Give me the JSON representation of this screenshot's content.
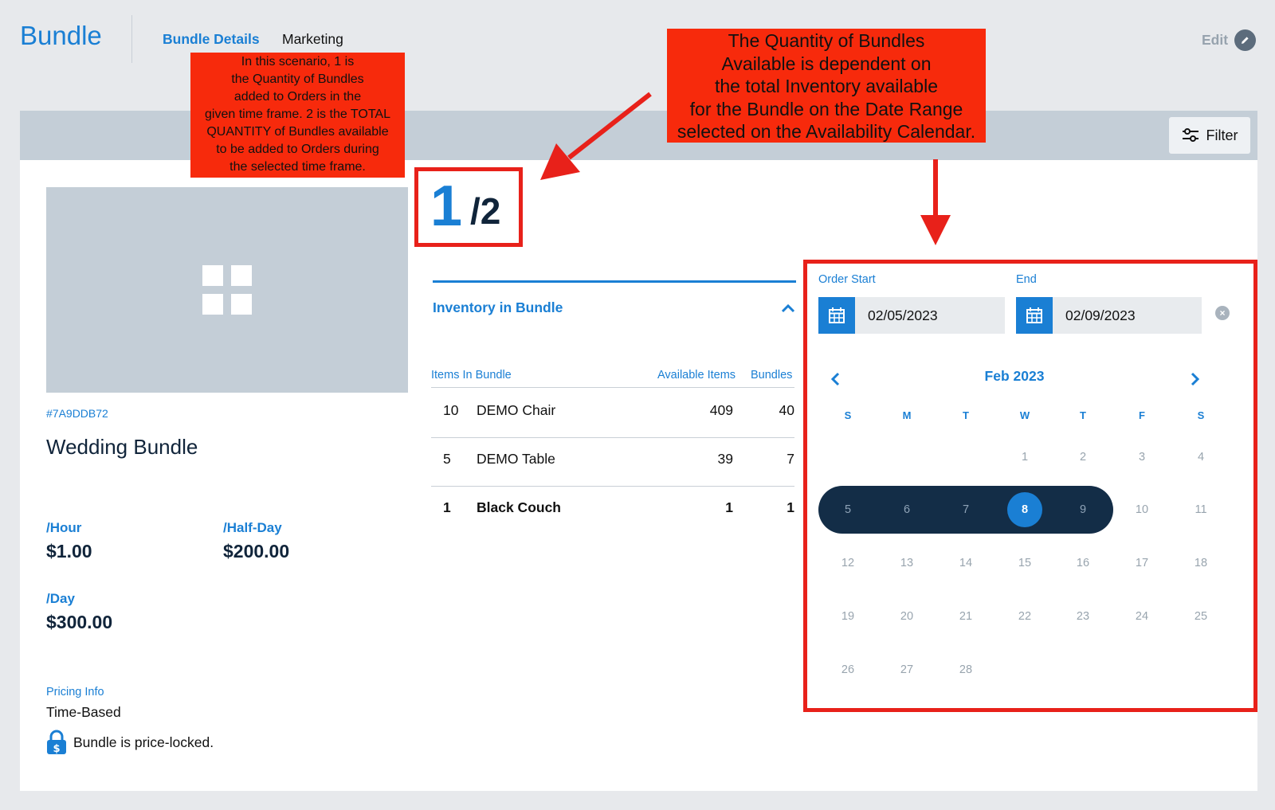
{
  "header": {
    "app_title": "Bundle",
    "tabs": [
      {
        "label": "Bundle Details",
        "active": true
      },
      {
        "label": "Marketing",
        "active": false
      }
    ],
    "edit_label": "Edit"
  },
  "toolbar": {
    "filter_label": "Filter"
  },
  "bundle": {
    "code": "#7A9DDB72",
    "name": "Wedding Bundle",
    "prices": [
      {
        "label": "/Hour",
        "value": "$1.00"
      },
      {
        "label": "/Half-Day",
        "value": "$200.00"
      },
      {
        "label": "/Day",
        "value": "$300.00"
      }
    ],
    "pricing_info_label": "Pricing Info",
    "pricing_info_value": "Time-Based",
    "price_locked_text": "Bundle is price-locked."
  },
  "availability": {
    "used": "1",
    "total": "/2"
  },
  "inventory": {
    "title": "Inventory in Bundle",
    "headers": [
      "Items In Bundle",
      "Available Items",
      "Bundles"
    ],
    "rows": [
      {
        "qty": "10",
        "item": "DEMO Chair",
        "available": "409",
        "bundles": "40",
        "bold": false
      },
      {
        "qty": "5",
        "item": "DEMO Table",
        "available": "39",
        "bundles": "7",
        "bold": false
      },
      {
        "qty": "1",
        "item": "Black Couch",
        "available": "1",
        "bundles": "1",
        "bold": true
      }
    ]
  },
  "calendar": {
    "start_label": "Order Start",
    "start_value": "02/05/2023",
    "end_label": "End",
    "end_value": "02/09/2023",
    "month_label": "Feb 2023",
    "weekdays": [
      "S",
      "M",
      "T",
      "W",
      "T",
      "F",
      "S"
    ],
    "weeks": [
      [
        "",
        "",
        "",
        "1",
        "2",
        "3",
        "4"
      ],
      [
        "5",
        "6",
        "7",
        "8",
        "9",
        "10",
        "11"
      ],
      [
        "12",
        "13",
        "14",
        "15",
        "16",
        "17",
        "18"
      ],
      [
        "19",
        "20",
        "21",
        "22",
        "23",
        "24",
        "25"
      ],
      [
        "26",
        "27",
        "28",
        "",
        "",
        "",
        ""
      ]
    ],
    "selected_day": "8",
    "range_days": [
      "5",
      "6",
      "7",
      "8",
      "9"
    ]
  },
  "annotations": {
    "left_note": [
      "In this scenario, 1 is",
      "the Quantity of Bundles",
      "added to Orders in the",
      "given time frame. 2 is the TOTAL",
      "QUANTITY of Bundles available",
      "to be added to Orders during",
      "the selected time frame."
    ],
    "right_note": [
      "The Quantity of Bundles",
      "Available is dependent on",
      "the total Inventory available",
      "for the Bundle on the Date Range",
      "selected on the Availability Calendar."
    ]
  },
  "colors": {
    "accent": "#1a7fd4",
    "navy": "#132d47",
    "annotation_red": "#f72a0c",
    "highlight_border": "#e8211a"
  }
}
